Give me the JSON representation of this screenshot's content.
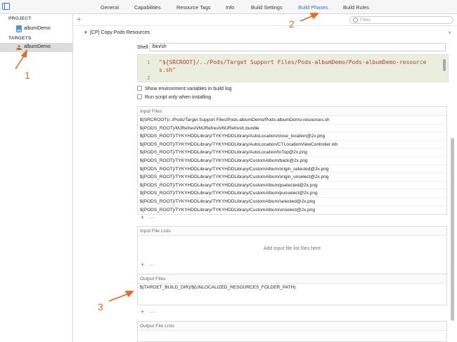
{
  "tabs": [
    {
      "label": "General",
      "active": false
    },
    {
      "label": "Capabilities",
      "active": false
    },
    {
      "label": "Resource Tags",
      "active": false
    },
    {
      "label": "Info",
      "active": false
    },
    {
      "label": "Build Settings",
      "active": false
    },
    {
      "label": "Build Phases",
      "active": true
    },
    {
      "label": "Build Rules",
      "active": false
    }
  ],
  "sidebar": {
    "project_header": "PROJECT",
    "project_item": "albumDemo",
    "targets_header": "TARGETS",
    "target_item": "albumDemo"
  },
  "toolbar": {
    "add_label": "+",
    "filter_placeholder": "Filter"
  },
  "phase": {
    "title": "[CP] Copy Pods Resources",
    "close_label": "×",
    "shell_label": "Shell",
    "shell_value": "/bin/sh",
    "script_line_numbers": [
      "1",
      "2"
    ],
    "script_text": "\"${SRCROOT}/../Pods/Target Support Files/Pods-albumDemo/Pods-albumDemo-resources.sh\"",
    "env_checkbox_label": "Show environment variables in build log",
    "install_checkbox_label": "Run script only when installing",
    "input_files_header": "Input Files",
    "input_files": [
      "$(SRCROOT)/../Pods/Target Support Files/Pods-albumDemo/Pods-albumDemo-resources.sh",
      "${PODS_ROOT}/MJRefresh/MJRefresh/MJRefresh.bundle",
      "${PODS_ROOT}/TYKYHDDLibrary/TYKYHDDLibrary/AutoLocation/close_location@2x.png",
      "${PODS_ROOT}/TYKYHDDLibrary/TYKYHDDLibrary/AutoLocation/CTLocationViewController.xib",
      "${PODS_ROOT}/TYKYHDDLibrary/TYKYHDDLibrary/AutoLocation/toTop@2x.png",
      "${PODS_ROOT}/TYKYHDDLibrary/TYKYHDDLibrary/CustomAlbum/back@2x.png",
      "${PODS_ROOT}/TYKYHDDLibrary/TYKYHDDLibrary/CustomAlbum/origin_selected@2x.png",
      "${PODS_ROOT}/TYKYHDDLibrary/TYKYHDDLibrary/CustomAlbum/origin_unselect@2x.png",
      "${PODS_ROOT}/TYKYHDDLibrary/TYKYHDDLibrary/CustomAlbum/pselected@2x.png",
      "${PODS_ROOT}/TYKYHDDLibrary/TYKYHDDLibrary/CustomAlbum/punselect@2x.png",
      "${PODS_ROOT}/TYKYHDDLibrary/TYKYHDDLibrary/CustomAlbum/selected@2x.png",
      "${PODS_ROOT}/TYKYHDDLibrary/TYKYHDDLibrary/CustomAlbum/unselect@2x.png"
    ],
    "input_file_lists_header": "Input File Lists",
    "input_file_lists_empty": "Add input file list files here",
    "output_files_header": "Output Files",
    "output_files": [
      "$(TARGET_BUILD_DIR)/$(UNLOCALIZED_RESOURCES_FOLDER_PATH)"
    ],
    "output_file_lists_header": "Output File Lists",
    "add_label": "+",
    "remove_label": "—"
  },
  "annotations": {
    "one": "1",
    "two": "2",
    "three": "3"
  },
  "colors": {
    "accent": "#2a73d9",
    "annotation": "#e8691f",
    "script_text": "#c3382b",
    "script_bg": "#e9eedd",
    "selected_row": "#dcdcdc"
  }
}
